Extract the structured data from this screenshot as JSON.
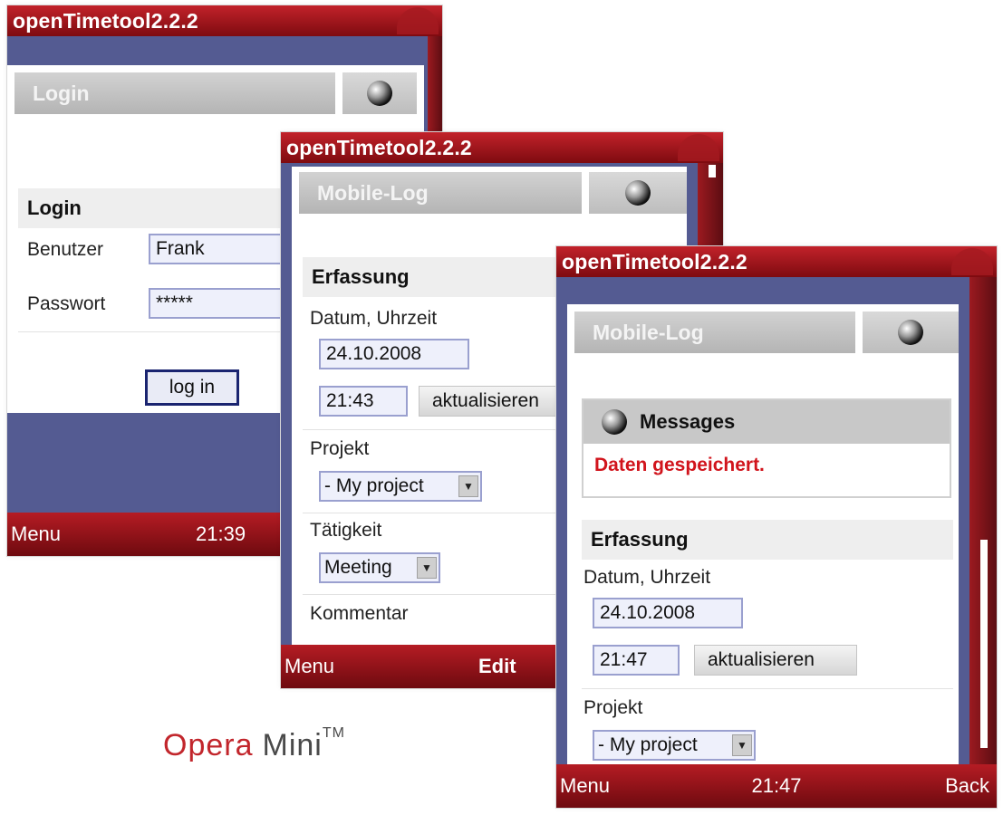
{
  "app_title": "openTimetool2.2.2",
  "screen_login": {
    "header_title": "Login",
    "section_title": "Login",
    "user_label": "Benutzer",
    "user_value": "Frank",
    "password_label": "Passwort",
    "password_value": "*****",
    "login_button": "log in",
    "softkey_left": "Menu",
    "clock": "21:39"
  },
  "screen_log": {
    "header_title": "Mobile-Log",
    "section_title": "Erfassung",
    "datetime_label": "Datum, Uhrzeit",
    "date_value": "24.10.2008",
    "time_value": "21:43",
    "update_button": "aktualisieren",
    "project_label": "Projekt",
    "project_value": "- My project",
    "activity_label": "Tätigkeit",
    "activity_value": "Meeting",
    "comment_label": "Kommentar",
    "softkey_left": "Menu",
    "softkey_mid": "Edit"
  },
  "screen_saved": {
    "header_title": "Mobile-Log",
    "messages_title": "Messages",
    "message_text": "Daten gespeichert.",
    "section_title": "Erfassung",
    "datetime_label": "Datum, Uhrzeit",
    "date_value": "24.10.2008",
    "time_value": "21:47",
    "update_button": "aktualisieren",
    "project_label": "Projekt",
    "project_value": "- My project",
    "softkey_left": "Menu",
    "clock": "21:47",
    "softkey_right": "Back"
  },
  "branding": {
    "opera": "Opera",
    "mini": "Mini",
    "tm": "TM"
  },
  "colors": {
    "title_red": "#a51a20",
    "frame_blue": "#545b92",
    "message_red": "#d1141c"
  }
}
